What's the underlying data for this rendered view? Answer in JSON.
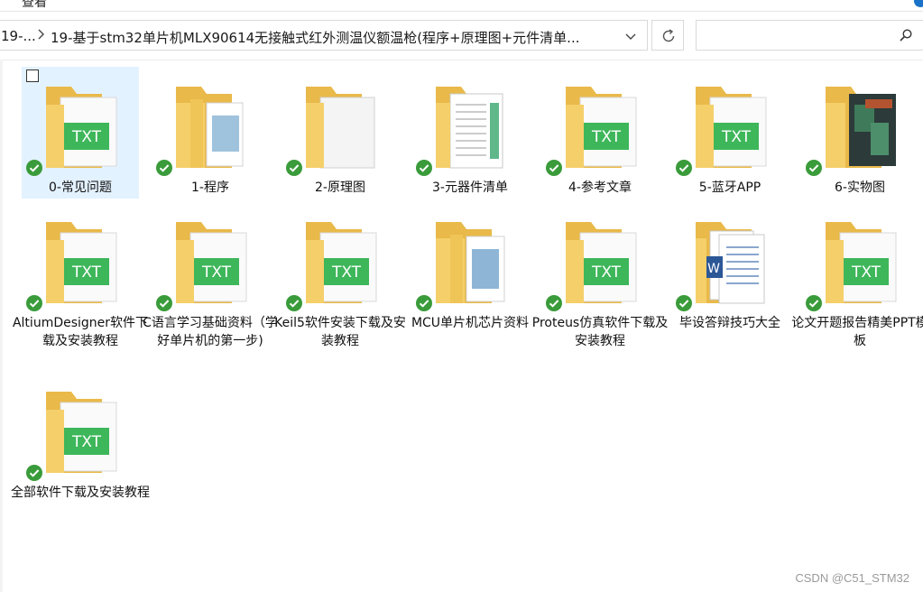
{
  "window": {
    "view_menu_label": "查看"
  },
  "address_bar": {
    "previous_crumb": "19-...",
    "current_crumb": "19-基于stm32单片机MLX90614无接触式红外测温仪额温枪(程序+原理图+元件清单..."
  },
  "search": {
    "placeholder": ""
  },
  "items": [
    {
      "label": "0-常见问题",
      "icon": "folder-txt-icon",
      "selected": true
    },
    {
      "label": "1-程序",
      "icon": "folder-image-icon"
    },
    {
      "label": "2-原理图",
      "icon": "folder-blank-page-icon"
    },
    {
      "label": "3-元器件清单",
      "icon": "folder-spreadsheet-icon"
    },
    {
      "label": "4-参考文章",
      "icon": "folder-txt-icon"
    },
    {
      "label": "5-蓝牙APP",
      "icon": "folder-txt-icon"
    },
    {
      "label": "6-实物图",
      "icon": "folder-photo-icon"
    },
    {
      "label": "AltiumDesigner软件下载及安装教程",
      "icon": "folder-txt-icon"
    },
    {
      "label": "C语言学习基础资料（学好单片机的第一步)",
      "icon": "folder-txt-icon"
    },
    {
      "label": "Keil5软件安装下载及安装教程",
      "icon": "folder-txt-icon"
    },
    {
      "label": "MCU单片机芯片资料",
      "icon": "folder-image-icon"
    },
    {
      "label": "Proteus仿真软件下载及安装教程",
      "icon": "folder-txt-icon"
    },
    {
      "label": "毕设答辩技巧大全",
      "icon": "folder-word-icon"
    },
    {
      "label": "论文开题报告精美PPT模板",
      "icon": "folder-txt-icon"
    },
    {
      "label": "全部软件下载及安装教程",
      "icon": "folder-txt-icon"
    }
  ],
  "sync_status_icon": "green-check-sync-icon",
  "colors": {
    "folder": "#f5cf6a",
    "folder_dark": "#e9b949",
    "txt_badge": "#3eb65a",
    "sync_green": "#3a9b3a",
    "selection": "#cce8ff"
  },
  "watermark": "CSDN @C51_STM32"
}
